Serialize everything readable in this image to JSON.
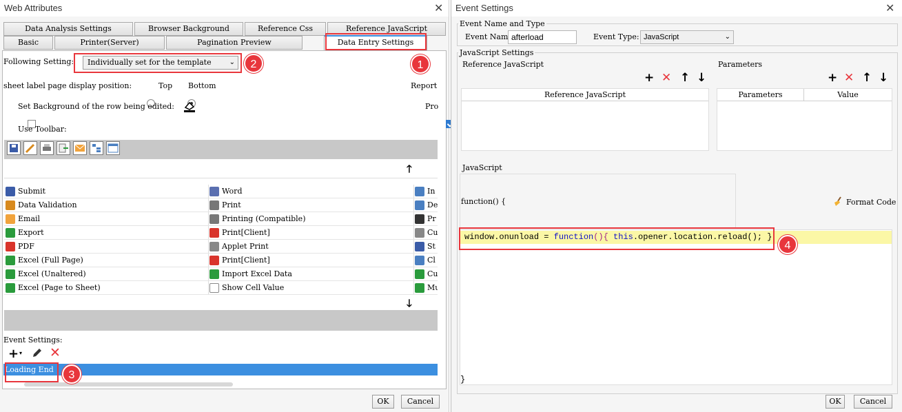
{
  "left": {
    "title": "Web Attributes",
    "tabs_row1": [
      "Data Analysis Settings",
      "Browser Background",
      "Reference Css",
      "Reference JavaScript"
    ],
    "tabs_row2": [
      "Basic",
      "Printer(Server)",
      "Pagination Preview",
      "Data Entry Settings"
    ],
    "following_label": "Following Setting:",
    "following_value": "Individually set for the template",
    "sheet_label": "sheet label page display position:",
    "radio_top": "Top",
    "radio_bottom": "Bottom",
    "report_label": "Report",
    "set_bg_label": "Set Background of the row being edited:",
    "pro_label": "Pro",
    "use_toolbar_label": "Use Toolbar:",
    "grid_col1": [
      "Submit",
      "Data Validation",
      "Email",
      "Export",
      "PDF",
      "Excel (Full Page)",
      "Excel (Unaltered)",
      "Excel (Page to Sheet)"
    ],
    "grid_col2": [
      "Word",
      "Print",
      "Printing (Compatible)",
      "Print[Client]",
      "Applet Print",
      "Print[Client]",
      "Import Excel Data",
      "Show Cell Value"
    ],
    "grid_col3": [
      "In",
      "De",
      "Pr",
      "Cu",
      "St",
      "Cl",
      "Cu",
      "Mu"
    ],
    "event_settings_label": "Event Settings:",
    "event_item": "Loading End",
    "ok": "OK",
    "cancel": "Cancel"
  },
  "right": {
    "title": "Event Settings",
    "group_name_type": "Event Name and Type",
    "event_name_label": "Event Name:",
    "event_name_value": "afterload",
    "event_type_label": "Event Type:",
    "event_type_value": "JavaScript",
    "group_js_settings": "JavaScript Settings",
    "ref_js_label": "Reference JavaScript",
    "params_label": "Parameters",
    "ref_js_header": "Reference JavaScript",
    "params_header": "Parameters",
    "value_header": "Value",
    "js_label": "JavaScript",
    "func_open": "function() {",
    "format_code": "Format Code",
    "code_line": {
      "p1": "window.onunload = ",
      "kw1": "function",
      "p2": "(){ ",
      "kw2": "this",
      "p3": ".opener.location.reload(); }"
    },
    "func_close": "}",
    "ok": "OK",
    "cancel": "Cancel"
  },
  "badges": [
    "1",
    "2",
    "3",
    "4"
  ],
  "colors": {
    "annotation": "#e8363c",
    "selection": "#3c8fe0",
    "code_highlight": "#fbf7a6",
    "keyword": "#1010c8"
  }
}
